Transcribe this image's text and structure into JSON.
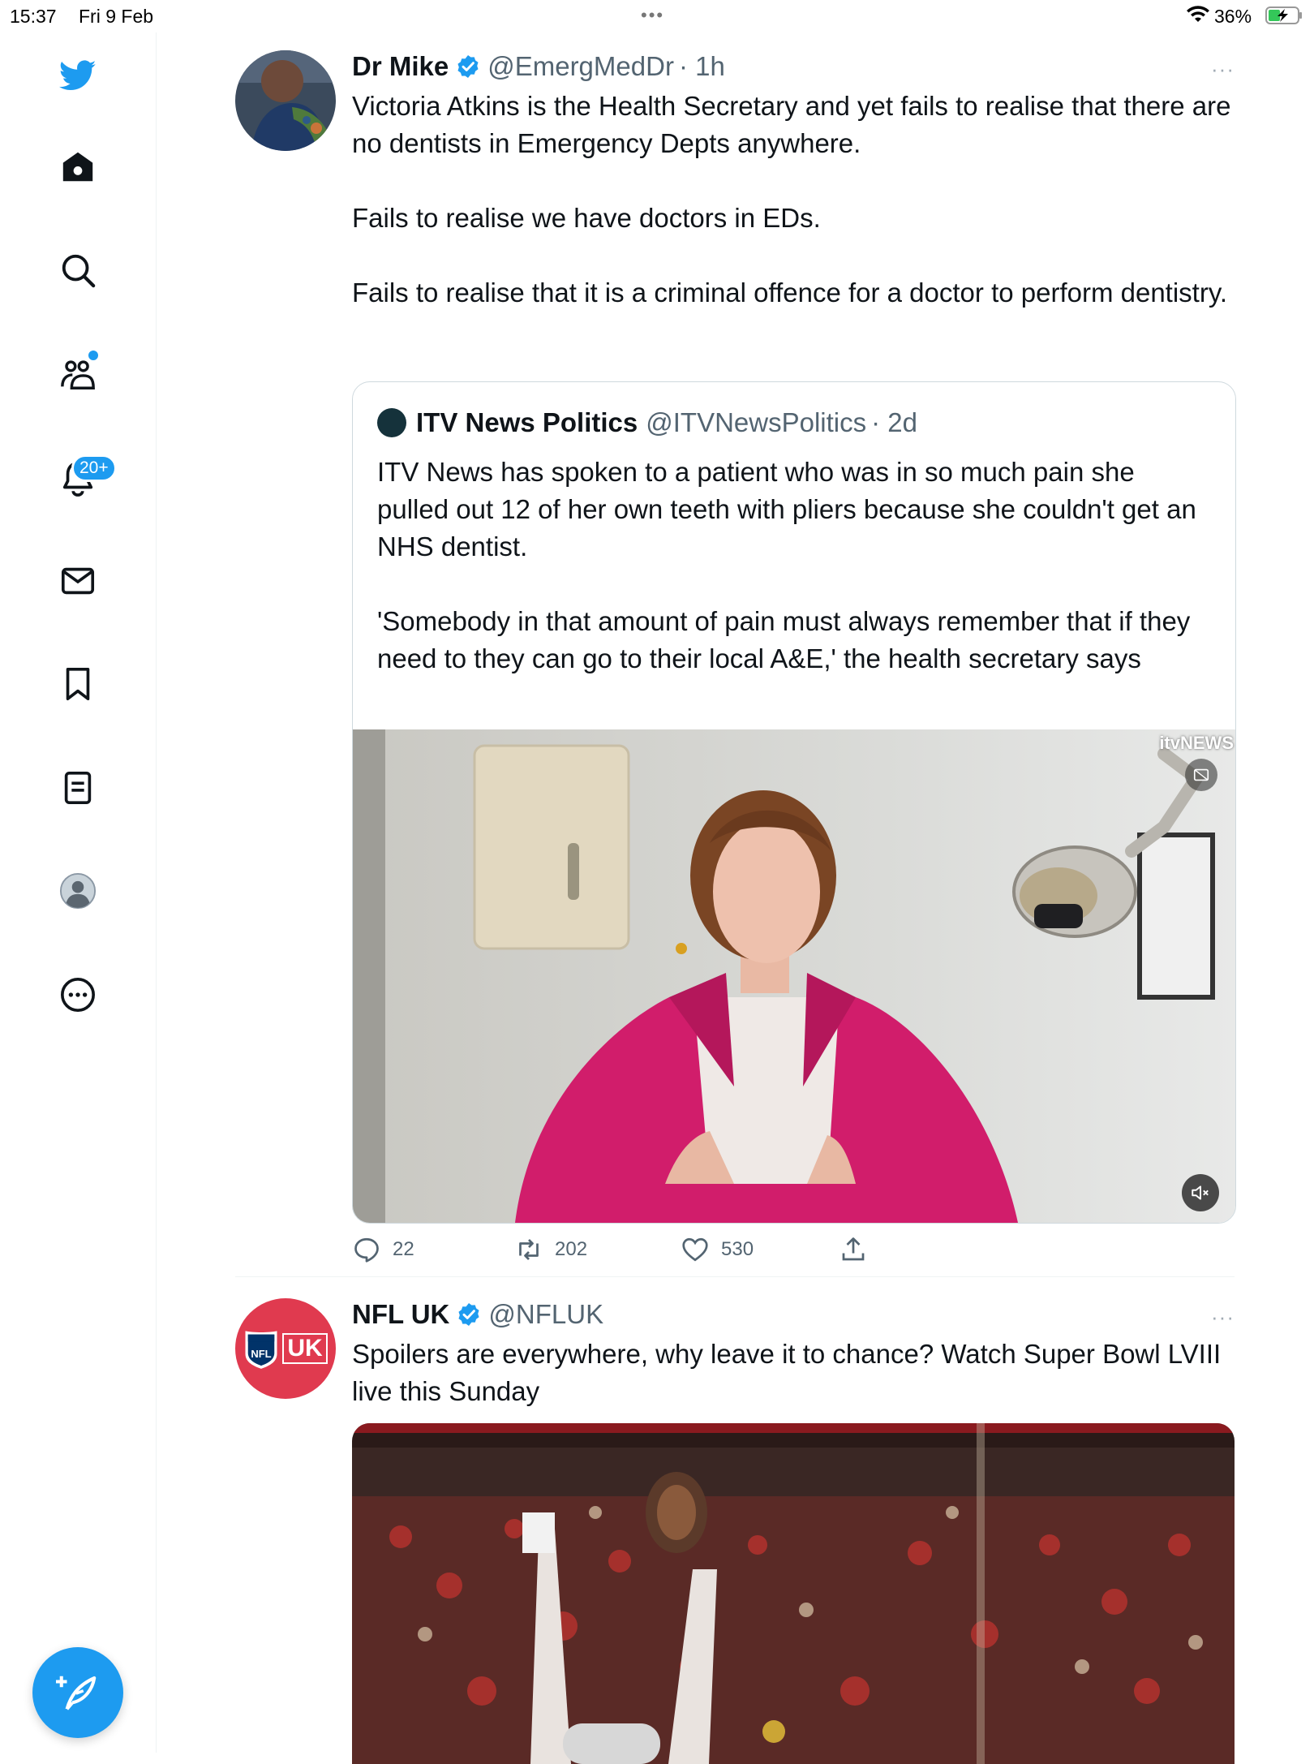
{
  "status_bar": {
    "time": "15:37",
    "date": "Fri 9 Feb",
    "battery": "36%",
    "multitask_dots": "•••"
  },
  "sidebar": {
    "items": [
      {
        "name": "twitter-logo",
        "icon": "bird-icon"
      },
      {
        "name": "home",
        "icon": "home-icon"
      },
      {
        "name": "explore",
        "icon": "search-icon"
      },
      {
        "name": "communities",
        "icon": "people-icon"
      },
      {
        "name": "notifications",
        "icon": "bell-icon",
        "badge": "20+"
      },
      {
        "name": "messages",
        "icon": "mail-icon"
      },
      {
        "name": "bookmarks",
        "icon": "bookmark-icon"
      },
      {
        "name": "lists",
        "icon": "list-icon"
      },
      {
        "name": "profile",
        "icon": "avatar-icon"
      },
      {
        "name": "more",
        "icon": "more-icon"
      }
    ],
    "compose": {
      "icon": "compose-icon"
    }
  },
  "colors": {
    "accent": "#1d9bf0",
    "text_primary": "#0f1419",
    "text_secondary": "#536471",
    "nfl_red": "#e03a4f"
  },
  "tweets": [
    {
      "name": "Dr Mike",
      "handle": "@EmergMedDr",
      "time": "· 1h",
      "more": "···",
      "paragraphs": [
        "Victoria Atkins is the Health Secretary and yet fails to realise that there are no dentists in Emergency Depts anywhere.",
        "Fails to realise we have doctors in EDs.",
        "Fails to realise that it is a criminal offence for a doctor to perform dentistry."
      ],
      "quote": {
        "name": "ITV News Politics",
        "handle": "@ITVNewsPolitics",
        "time": "· 2d",
        "paragraphs": [
          "ITV News has spoken to a patient who was in so much pain she pulled out 12 of her own teeth with pliers because she couldn't get an NHS dentist.",
          "'Somebody in that amount of pain must always remember that if they need to they can go to their local A&E,' the health secretary says"
        ],
        "media_watermark": "itvNEWS"
      },
      "actions": {
        "replies": "22",
        "retweets": "202",
        "likes": "530"
      }
    },
    {
      "name": "NFL UK",
      "handle": "@NFLUK",
      "more": "···",
      "avatar_text": "UK",
      "paragraphs": [
        "Spoilers are everywhere, why leave it to chance? Watch Super Bowl LVIII live this Sunday"
      ]
    }
  ]
}
